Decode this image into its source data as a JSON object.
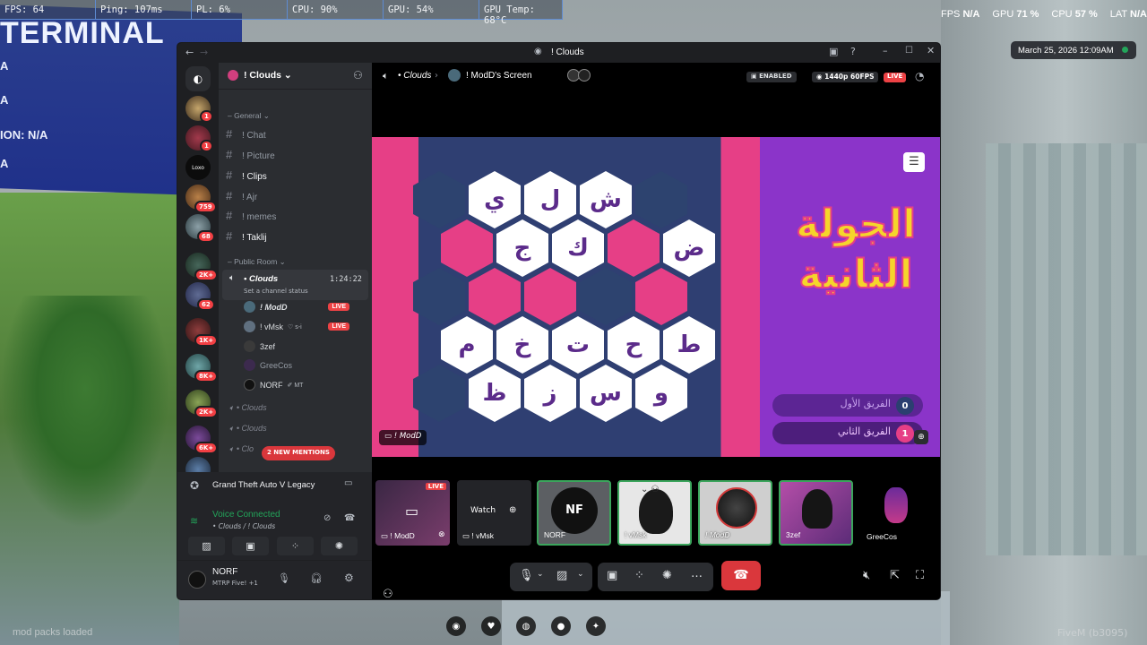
{
  "perf_overlay": {
    "cells": [
      "FPS: 64",
      "Ping: 107ms",
      "PL: 6%",
      "CPU: 90%",
      "GPU: 54%",
      "GPU Temp: 68°C"
    ],
    "right": {
      "fps_label": "FPS",
      "fps_value": "N/A",
      "gpu_label": "GPU",
      "gpu_value": "71 %",
      "cpu_label": "CPU",
      "cpu_value": "57 %",
      "lat_label": "LAT",
      "lat_value": "N/A"
    }
  },
  "datetime": "March 25, 2026 12:09AM",
  "game_bg": {
    "terminal_title": "TERMINAL",
    "terminal_lines": [
      "A",
      "A",
      "ION: N/A",
      "A"
    ],
    "footer_left": "mod packs loaded",
    "footer_right": "FiveM (b3095)"
  },
  "window": {
    "title": "! Clouds",
    "back_icon": "arrow-left",
    "forward_icon": "arrow-right"
  },
  "server_rail": {
    "badges": [
      "1",
      "1",
      "759",
      "68",
      "2K+",
      "62",
      "1K+",
      "8K+",
      "2K+",
      "6K+"
    ],
    "loxo_label": "Loxo"
  },
  "channels": {
    "server_name": "! Clouds",
    "categories": {
      "general": "General",
      "public_room": "Public Room"
    },
    "text_channels": [
      "! Chat",
      "! Picture",
      "! Clips",
      "! Ajr",
      "! memes",
      "! Taklij"
    ],
    "voice_channel": {
      "name": "• Clouds",
      "timer": "1:24:22",
      "status": "Set a channel status"
    },
    "voice_users": [
      {
        "name": "! ModD",
        "live": "LIVE"
      },
      {
        "name": "! vMsk",
        "tag": "s-i",
        "live": "LIVE"
      },
      {
        "name": "3zef"
      },
      {
        "name": "GreeCos"
      },
      {
        "name": "NORF",
        "tag": "MT"
      }
    ],
    "other_voice": [
      "• Clouds",
      "• Clouds",
      "• Clo"
    ],
    "mentions_pill": "2 NEW MENTIONS"
  },
  "user_panel": {
    "activity": "Grand Theft Auto V Legacy",
    "voice_status": "Voice Connected",
    "voice_path": "• Clouds / ! Clouds",
    "username": "NORF",
    "user_status": "MTRP Five! +1"
  },
  "stage_header": {
    "channel": "• Clouds",
    "screen_title": "! ModD's Screen",
    "enabled_label": "ENABLED",
    "quality": "1440p 60FPS",
    "live": "LIVE"
  },
  "game": {
    "round_title_line1": "الجولة",
    "round_title_line2": "الثانية",
    "team1": {
      "name": "الفريق الأول",
      "score": "0"
    },
    "team2": {
      "name": "الفريق الثاني",
      "score": "1"
    },
    "letters_row1": [
      "ي",
      "ل",
      "ش"
    ],
    "letters_row2": [
      "ج",
      "ك",
      "ض"
    ],
    "letters_row4": [
      "م",
      "خ",
      "ت",
      "ح",
      "ط"
    ],
    "letters_row5": [
      "ظ",
      "ز",
      "س",
      "و"
    ],
    "streamer_tag": "! ModD"
  },
  "tiles": [
    {
      "label": "! ModD",
      "live": "LIVE"
    },
    {
      "label": "! vMsk",
      "watch": "Watch"
    },
    {
      "label": "NORF",
      "initials": "NF"
    },
    {
      "label": "! vMsk"
    },
    {
      "label": "! ModD"
    },
    {
      "label": "3zef"
    },
    {
      "label": "GreeCos"
    }
  ],
  "colors": {
    "board_pink": "#e63f86",
    "board_navy": "#2d436f",
    "panel_purple": "#8b34c9",
    "live_red": "#ed4245",
    "end_call_red": "#da373c",
    "discord_blurple": "#5865f2"
  }
}
